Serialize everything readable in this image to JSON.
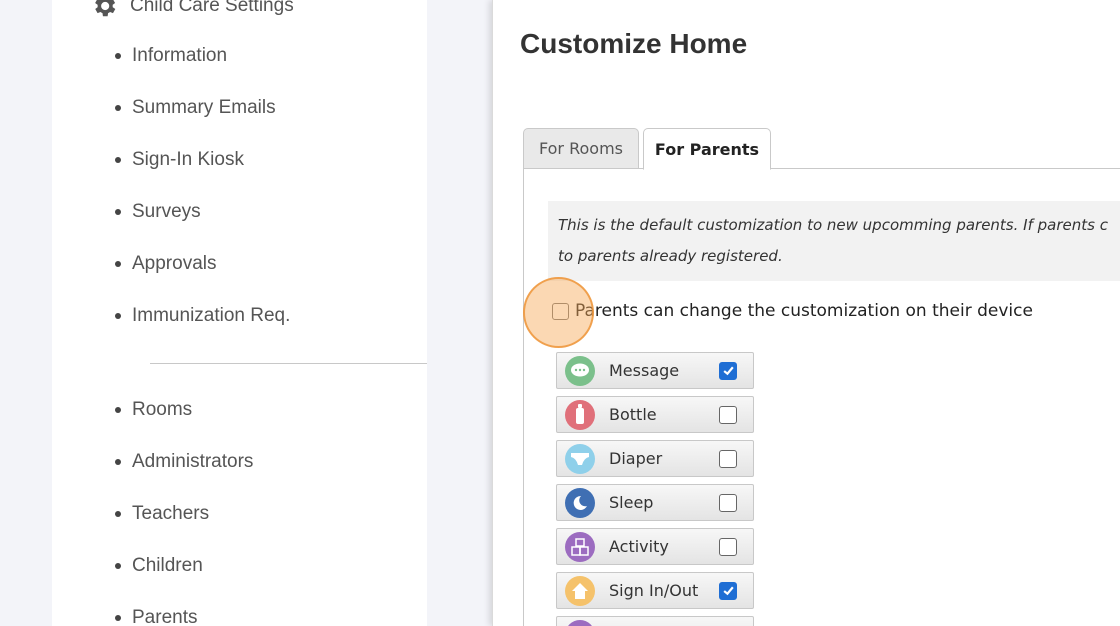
{
  "sidebar": {
    "header": "Child Care Settings",
    "items_top": [
      "Information",
      "Summary Emails",
      "Sign-In Kiosk",
      "Surveys",
      "Approvals",
      "Immunization Req."
    ],
    "items_bottom": [
      "Rooms",
      "Administrators",
      "Teachers",
      "Children",
      "Parents"
    ]
  },
  "main": {
    "title": "Customize Home",
    "tabs": [
      {
        "label": "For Rooms",
        "active": false
      },
      {
        "label": "For Parents",
        "active": true
      }
    ],
    "info_line1": "This is the default customization to new upcomming parents. If parents c",
    "info_line2": "to parents already registered.",
    "permission_label": "Parents can change the customization on their device",
    "permission_checked": false,
    "cards": [
      {
        "label": "Message",
        "icon": "message-icon",
        "color": "#7bc08b",
        "checked": true
      },
      {
        "label": "Bottle",
        "icon": "bottle-icon",
        "color": "#e0707a",
        "checked": false
      },
      {
        "label": "Diaper",
        "icon": "diaper-icon",
        "color": "#8fd0ea",
        "checked": false
      },
      {
        "label": "Sleep",
        "icon": "sleep-icon",
        "color": "#3f6fb3",
        "checked": false
      },
      {
        "label": "Activity",
        "icon": "activity-icon",
        "color": "#9c6cc0",
        "checked": false
      },
      {
        "label": "Sign In/Out",
        "icon": "home-icon",
        "color": "#f5c26b",
        "checked": true
      }
    ]
  },
  "colors": {
    "accent": "#1f6ed4",
    "highlight": "#f7a856"
  }
}
